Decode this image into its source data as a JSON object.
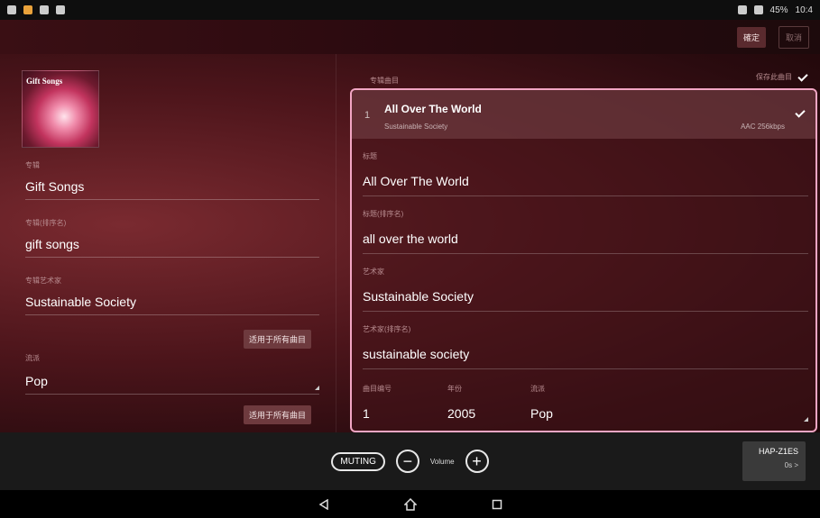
{
  "status": {
    "right_text": "10:4",
    "battery": "45%"
  },
  "topbar": {
    "ok_label": "確定",
    "cancel_label": "取消"
  },
  "album": {
    "art_text": "Gift Songs",
    "label": "专辑",
    "value": "Gift Songs",
    "sort_label": "专辑(排序名)",
    "sort_value": "gift songs",
    "artist_label": "专辑艺术家",
    "artist_value": "Sustainable Society",
    "apply_all_1": "适用于所有曲目",
    "genre_label": "流派",
    "genre_value": "Pop",
    "apply_all_2": "适用于所有曲目"
  },
  "right": {
    "header_label": "专辑曲目",
    "save_label": "保存此曲目"
  },
  "track": {
    "number": "1",
    "title": "All Over The World",
    "artist": "Sustainable Society",
    "codec": "AAC 256kbps",
    "checked": true
  },
  "fields": {
    "title_label": "标题",
    "title_value": "All Over The World",
    "title_sort_label": "标题(排序名)",
    "title_sort_value": "all over the world",
    "artist_label": "艺术家",
    "artist_value": "Sustainable Society",
    "artist_sort_label": "艺术家(排序名)",
    "artist_sort_value": "sustainable society",
    "track_no_label": "曲目编号",
    "track_no_value": "1",
    "year_label": "年份",
    "year_value": "2005",
    "genre_label": "流派",
    "genre_value": "Pop"
  },
  "bottom": {
    "muting_label": "MUTING",
    "minus_label": "−",
    "volume_label": "Volume",
    "plus_label": "+",
    "device_name": "HAP-Z1ES",
    "device_sub": "0s >"
  },
  "icons": {
    "back": "back-icon",
    "home": "home-icon",
    "recents": "recents-icon"
  },
  "colors": {
    "accent_border": "#f2a6c4",
    "panel_bg": "#4d151b"
  }
}
